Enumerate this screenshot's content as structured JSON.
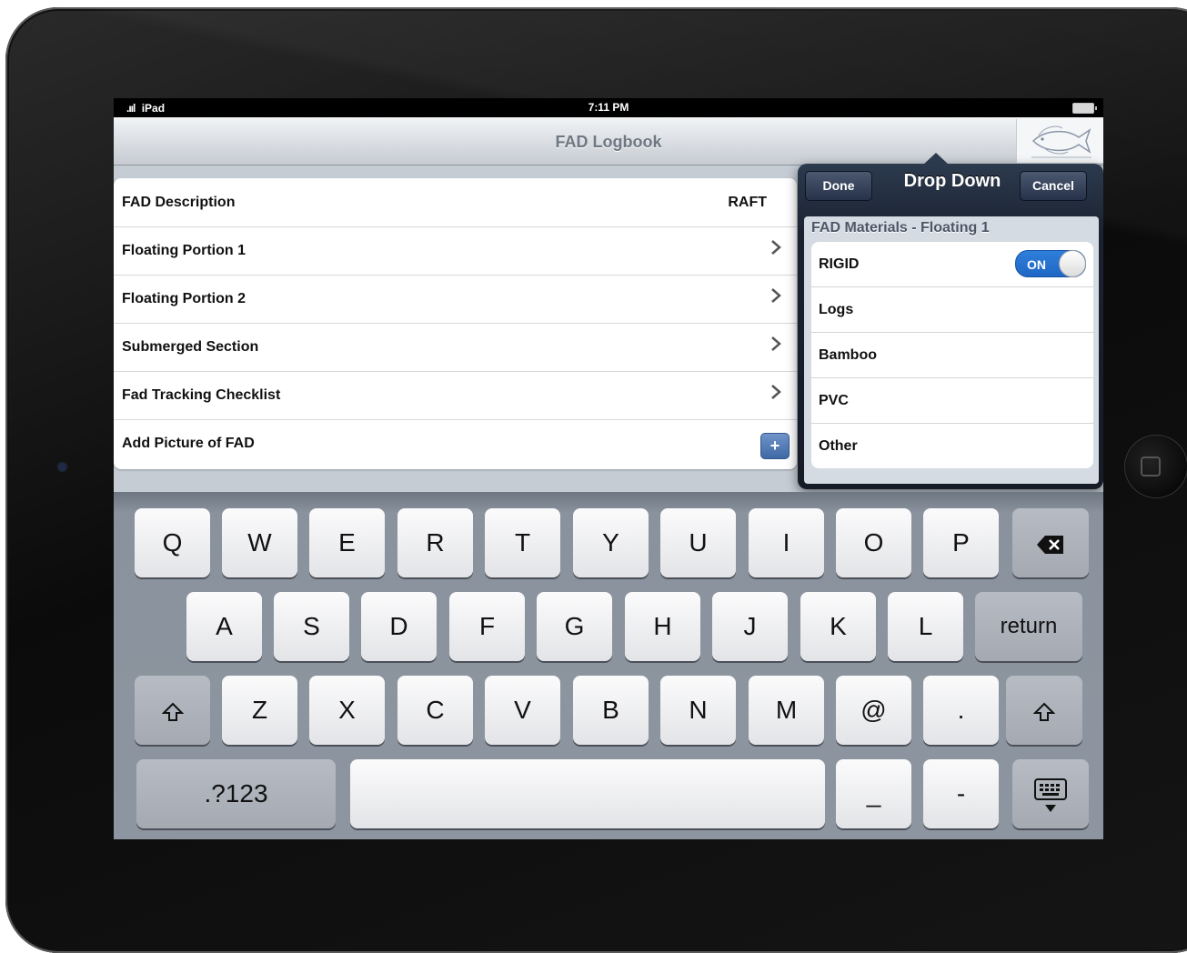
{
  "status_bar": {
    "signal": ".ııl",
    "carrier": "iPad",
    "time": "7:11 PM"
  },
  "nav": {
    "title": "FAD Logbook",
    "logo_name": "iss-foundation-logo"
  },
  "table": {
    "rows": [
      {
        "label": "FAD Description",
        "value": "RAFT"
      },
      {
        "label": "Floating Portion 1"
      },
      {
        "label": "Floating Portion 2"
      },
      {
        "label": "Submerged Section"
      },
      {
        "label": "Fad Tracking Checklist"
      },
      {
        "label": "Add Picture of FAD",
        "action": "+"
      }
    ]
  },
  "popover": {
    "title": "Drop Down",
    "done_label": "Done",
    "cancel_label": "Cancel",
    "section_header": "FAD Materials - Floating 1",
    "items": [
      {
        "label": "RIGID",
        "toggle": "ON"
      },
      {
        "label": "Logs"
      },
      {
        "label": "Bamboo"
      },
      {
        "label": "PVC"
      },
      {
        "label": "Other"
      }
    ]
  },
  "keyboard": {
    "row1": [
      "Q",
      "W",
      "E",
      "R",
      "T",
      "Y",
      "U",
      "I",
      "O",
      "P"
    ],
    "row2": [
      "A",
      "S",
      "D",
      "F",
      "G",
      "H",
      "J",
      "K",
      "L"
    ],
    "row2_return": "return",
    "row3": [
      "Z",
      "X",
      "C",
      "V",
      "B",
      "N",
      "M",
      "@",
      "."
    ],
    "row4_numbers": ".?123",
    "row4_underscore": "_",
    "row4_dash": "-"
  },
  "colors": {
    "accent_blue": "#2e7fdb",
    "popover_bg": "#1a2231"
  }
}
